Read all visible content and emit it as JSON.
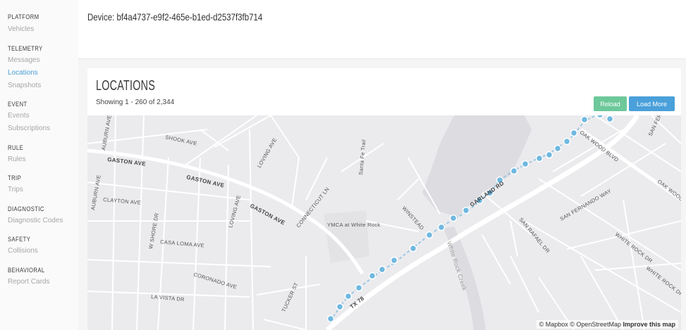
{
  "sidebar": {
    "sections": [
      {
        "title": "PLATFORM",
        "items": [
          {
            "label": "Vehicles",
            "active": false
          }
        ]
      },
      {
        "title": "TELEMETRY",
        "items": [
          {
            "label": "Messages",
            "active": false
          },
          {
            "label": "Locations",
            "active": true
          },
          {
            "label": "Snapshots",
            "active": false
          }
        ]
      },
      {
        "title": "EVENT",
        "items": [
          {
            "label": "Events",
            "active": false
          },
          {
            "label": "Subscriptions",
            "active": false
          }
        ]
      },
      {
        "title": "RULE",
        "items": [
          {
            "label": "Rules",
            "active": false
          }
        ]
      },
      {
        "title": "TRIP",
        "items": [
          {
            "label": "Trips",
            "active": false
          }
        ]
      },
      {
        "title": "DIAGNOSTIC",
        "items": [
          {
            "label": "Diagnostic Codes",
            "active": false
          }
        ]
      },
      {
        "title": "SAFETY",
        "items": [
          {
            "label": "Collisions",
            "active": false
          }
        ]
      },
      {
        "title": "BEHAVIORAL",
        "items": [
          {
            "label": "Report Cards",
            "active": false
          }
        ]
      }
    ]
  },
  "header": {
    "device_title": "Device: bf4a4737-e9f2-465e-b1ed-d2537f3fb714"
  },
  "panel": {
    "title": "LOCATIONS",
    "subtitle": "Showing 1 - 260 of 2,344",
    "reload_label": "Reload",
    "load_more_label": "Load More"
  },
  "map": {
    "attribution_mapbox": "© Mapbox",
    "attribution_osm": "© OpenStreetMap",
    "attribution_improve": "Improve this map",
    "labels": {
      "gaston_ave": "GASTON AVE",
      "shook_ave": "SHOOK AVE",
      "loving_ave": "LOVING AVE",
      "auburn_ave": "AUBURN AVE",
      "clayton_ave": "CLAYTON AVE",
      "connecticut_ln": "CONNECTICUT LN",
      "w_shore_dr": "W SHORE DR",
      "casa_loma_ave": "CASA LOMA AVE",
      "coronado_ave": "CORONADO AVE",
      "la_vista_dr": "LA VISTA DR",
      "tucker_st": "TUCKER ST",
      "ymca": "YMCA at White Rock",
      "santa_fe_trail": "Santa Fe Trail",
      "winstead": "WINSTEAD",
      "garland_rd": "GARLAND RD",
      "tx_78": "TX 78",
      "oak_wood_blvd": "OAK WOOD BLVD",
      "san_fernando_way": "SAN FERNANDO WAY",
      "san_fernando": "SAN FERNANDO",
      "san_rafael_dr": "SAN RAFAEL DR",
      "white_rock_dr": "WHITE ROCK DR",
      "white_rock_creek": "White Rock Creek",
      "oak_wood": "OAK WOOD"
    }
  },
  "colors": {
    "accent": "#4a9fd4",
    "reload": "#6dc89a",
    "load_more": "#4aa0da",
    "route_point": "#6fb8e0",
    "water": "#dcdce0"
  }
}
